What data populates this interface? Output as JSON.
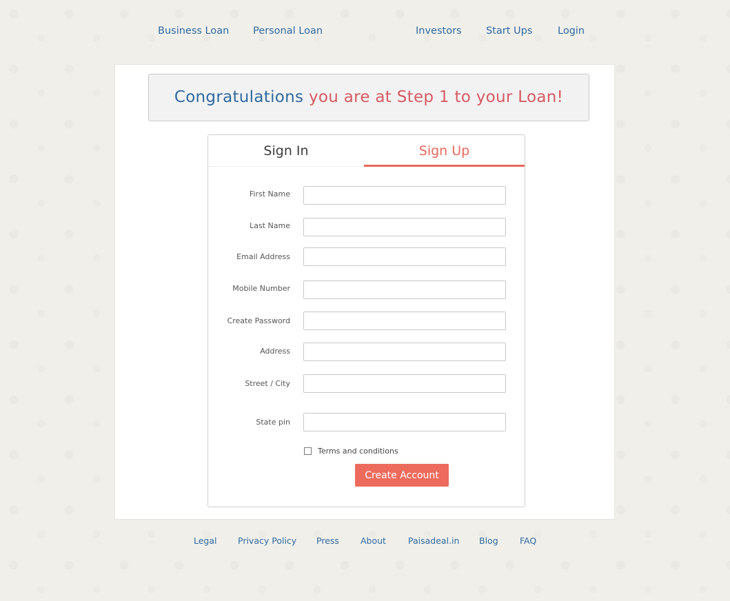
{
  "nav": {
    "business_loan": "Business Loan",
    "personal_loan": "Personal Loan",
    "investors": "Investors",
    "start_ups": "Start Ups",
    "login": "Login"
  },
  "banner": {
    "part1": "Congratulations",
    "part2": "you are at Step 1 to your Loan!"
  },
  "tabs": {
    "sign_in": "Sign In",
    "sign_up": "Sign Up",
    "active": "sign_up"
  },
  "form": {
    "first_name_label": "First Name",
    "last_name_label": "Last Name",
    "email_label": "Email Address",
    "mobile_label": "Mobile Number",
    "password_label": "Create Password",
    "address_label": "Address",
    "street_city_label": "Street / City",
    "state_pin_label": "State pin",
    "terms_label": "Terms and conditions",
    "terms_checked": false,
    "submit_label": "Create Account"
  },
  "footer": {
    "legal": "Legal",
    "privacy": "Privacy Policy",
    "press": "Press",
    "about": "About",
    "site": "Paisadeal.in",
    "blog": "Blog",
    "faq": "FAQ"
  },
  "colors": {
    "link_blue": "#2e6aa0",
    "accent_red": "#e8685b",
    "button_red": "#ec6b5c",
    "banner_red": "#d65a63"
  }
}
